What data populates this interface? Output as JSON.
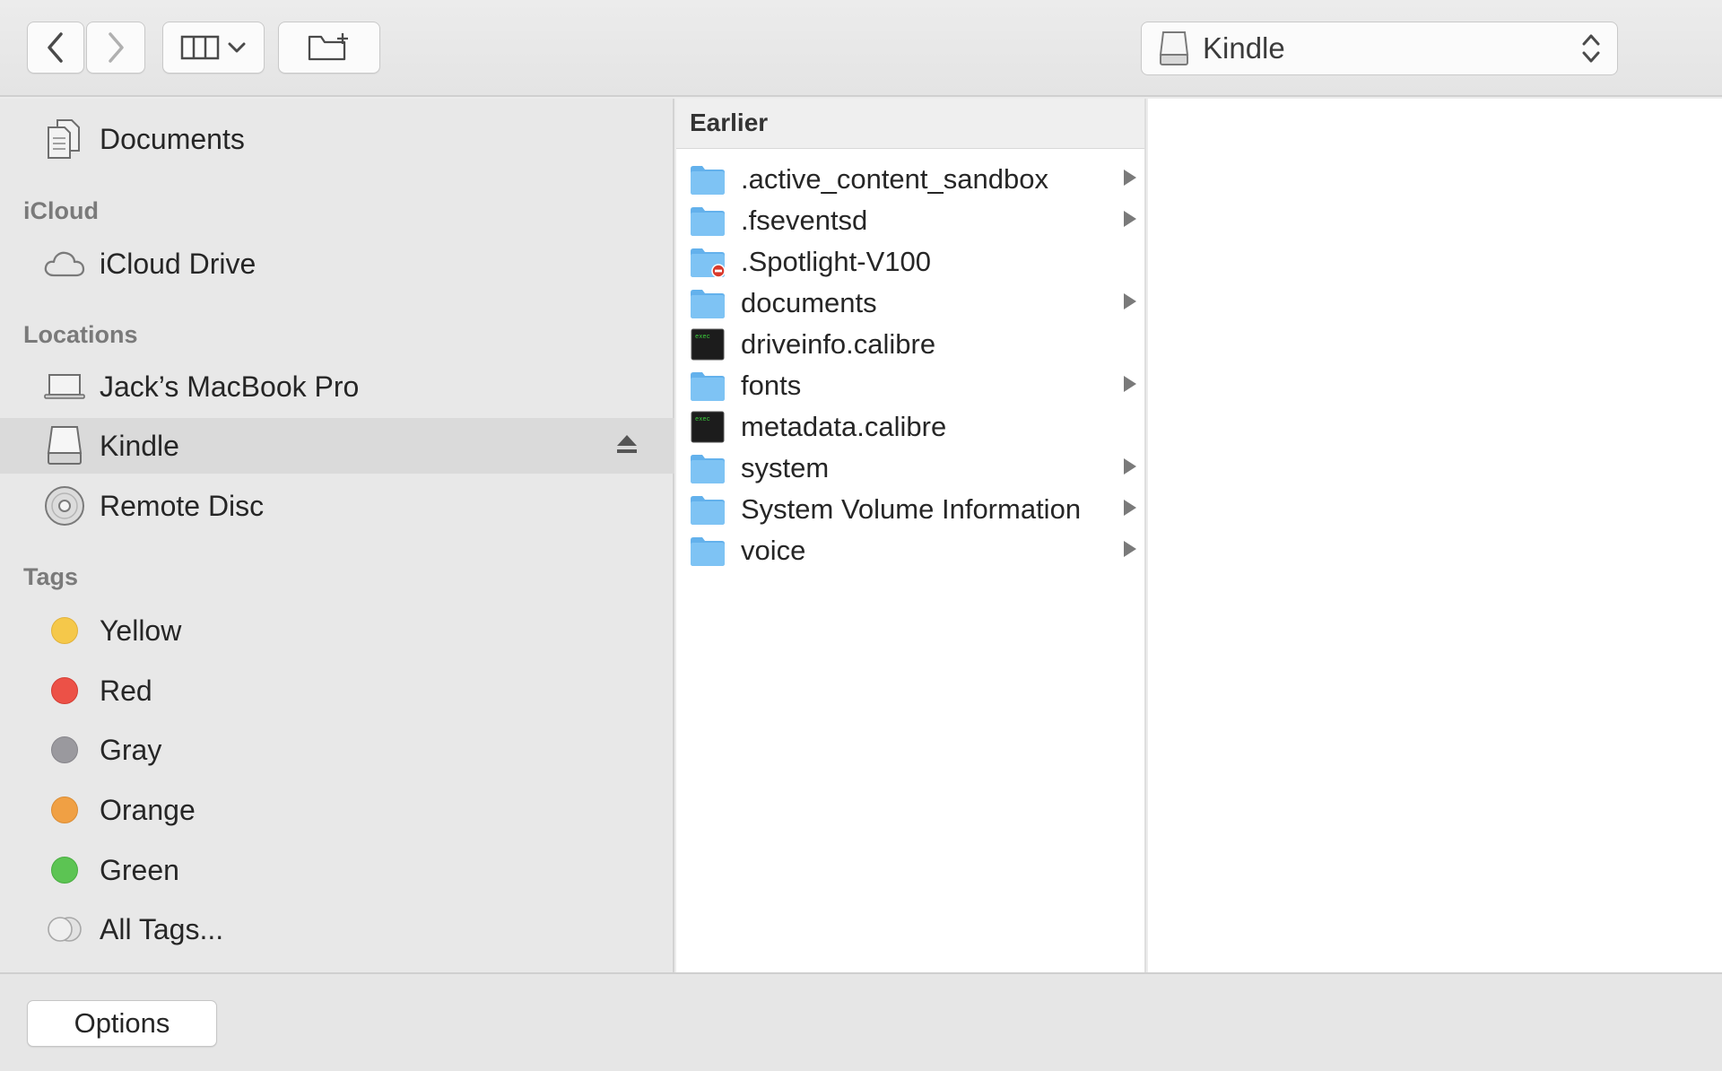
{
  "toolbar": {
    "back_icon": "chevron-left-icon",
    "forward_icon": "chevron-right-icon",
    "view_icon": "column-view-icon",
    "new_folder_icon": "new-folder-icon"
  },
  "location": {
    "label": "Kindle",
    "icon": "external-drive-icon"
  },
  "sidebar": {
    "favorites": [
      {
        "label": "Documents",
        "icon": "documents-icon"
      }
    ],
    "icloud_header": "iCloud",
    "icloud": [
      {
        "label": "iCloud Drive",
        "icon": "cloud-icon"
      }
    ],
    "locations_header": "Locations",
    "locations": [
      {
        "label": "Jack’s MacBook Pro",
        "icon": "laptop-icon"
      },
      {
        "label": "Kindle",
        "icon": "external-drive-icon",
        "selected": true,
        "eject_icon": "eject-icon"
      },
      {
        "label": "Remote Disc",
        "icon": "disc-icon"
      }
    ],
    "tags_header": "Tags",
    "tags": [
      {
        "label": "Yellow",
        "color": "#f5c84a"
      },
      {
        "label": "Red",
        "color": "#ec5147"
      },
      {
        "label": "Gray",
        "color": "#9a999e"
      },
      {
        "label": "Orange",
        "color": "#f0a044"
      },
      {
        "label": "Green",
        "color": "#5cc453"
      },
      {
        "label": "All Tags...",
        "icon": "all-tags-icon"
      }
    ]
  },
  "column": {
    "header": "Earlier",
    "items": [
      {
        "name": ".active_content_sandbox",
        "type": "folder",
        "has_children": true
      },
      {
        "name": ".fseventsd",
        "type": "folder",
        "has_children": true
      },
      {
        "name": ".Spotlight-V100",
        "type": "folder-restricted",
        "has_children": false
      },
      {
        "name": "documents",
        "type": "folder",
        "has_children": true
      },
      {
        "name": "driveinfo.calibre",
        "type": "exec-file",
        "has_children": false
      },
      {
        "name": "fonts",
        "type": "folder",
        "has_children": true
      },
      {
        "name": "metadata.calibre",
        "type": "exec-file",
        "has_children": false
      },
      {
        "name": "system",
        "type": "folder",
        "has_children": true
      },
      {
        "name": "System Volume Information",
        "type": "folder",
        "has_children": true
      },
      {
        "name": "voice",
        "type": "folder",
        "has_children": true
      }
    ]
  },
  "bottom": {
    "options_label": "Options"
  },
  "colors": {
    "folder": "#7ec3f4",
    "folder_tab": "#63b1ec",
    "restricted_badge": "#d8382b"
  }
}
